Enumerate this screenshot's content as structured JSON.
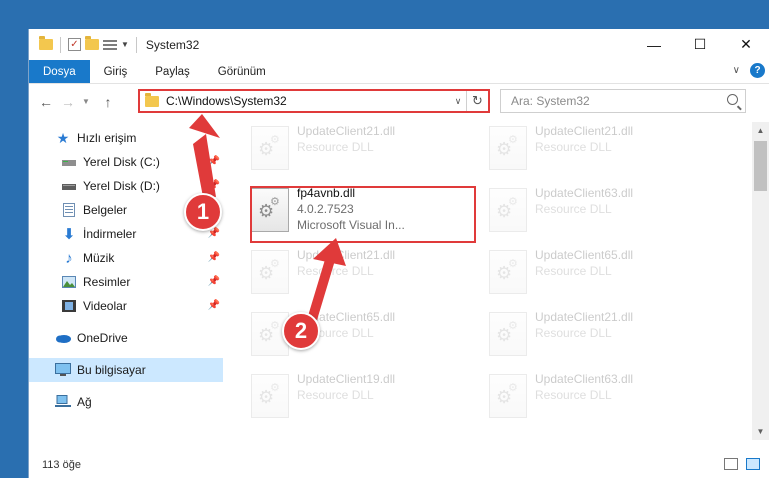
{
  "window": {
    "title": "System32",
    "minimize": "—",
    "maximize": "☐",
    "close": "✕"
  },
  "ribbon": {
    "tabs": [
      "Dosya",
      "Giriş",
      "Paylaş",
      "Görünüm"
    ],
    "help": "?"
  },
  "nav": {
    "address": "C:\\Windows\\System32",
    "search_placeholder": "Ara: System32"
  },
  "sidebar": {
    "items": [
      {
        "label": "Hızlı erişim",
        "icon": "star-icon"
      },
      {
        "label": "Yerel Disk (C:)",
        "icon": "drive-icon",
        "pinned": true
      },
      {
        "label": "Yerel Disk (D:)",
        "icon": "drive-icon",
        "pinned": true
      },
      {
        "label": "Belgeler",
        "icon": "documents-icon",
        "pinned": true
      },
      {
        "label": "İndirmeler",
        "icon": "download-icon",
        "pinned": true
      },
      {
        "label": "Müzik",
        "icon": "music-icon",
        "pinned": true
      },
      {
        "label": "Resimler",
        "icon": "pictures-icon",
        "pinned": true
      },
      {
        "label": "Videolar",
        "icon": "videos-icon",
        "pinned": true
      },
      {
        "label": "OneDrive",
        "icon": "cloud-icon"
      },
      {
        "label": "Bu bilgisayar",
        "icon": "computer-icon",
        "selected": true
      },
      {
        "label": "Ağ",
        "icon": "network-icon"
      }
    ]
  },
  "files": [
    {
      "name": "UpdateClient21.dll",
      "sub": "Resource DLL",
      "faded": true
    },
    {
      "name": "UpdateClient21.dll",
      "sub": "Resource DLL",
      "faded": true
    },
    {
      "name": "fp4avnb.dll",
      "version": "4.0.2.7523",
      "desc": "Microsoft Visual In...",
      "faded": false
    },
    {
      "name": "UpdateClient63.dll",
      "sub": "Resource DLL",
      "faded": true
    },
    {
      "name": "UpdateClient21.dll",
      "sub": "Resource DLL",
      "faded": true
    },
    {
      "name": "UpdateClient65.dll",
      "sub": "Resource DLL",
      "faded": true
    },
    {
      "name": "UpdateClient65.dll",
      "sub": "Resource DLL",
      "faded": true
    },
    {
      "name": "UpdateClient21.dll",
      "sub": "Resource DLL",
      "faded": true
    },
    {
      "name": "UpdateClient19.dll",
      "sub": "Resource DLL",
      "faded": true
    },
    {
      "name": "UpdateClient63.dll",
      "sub": "Resource DLL",
      "faded": true
    }
  ],
  "status": {
    "count": "113 öğe"
  },
  "annotations": {
    "badge1": "1",
    "badge2": "2",
    "color": "#e03a3a"
  }
}
